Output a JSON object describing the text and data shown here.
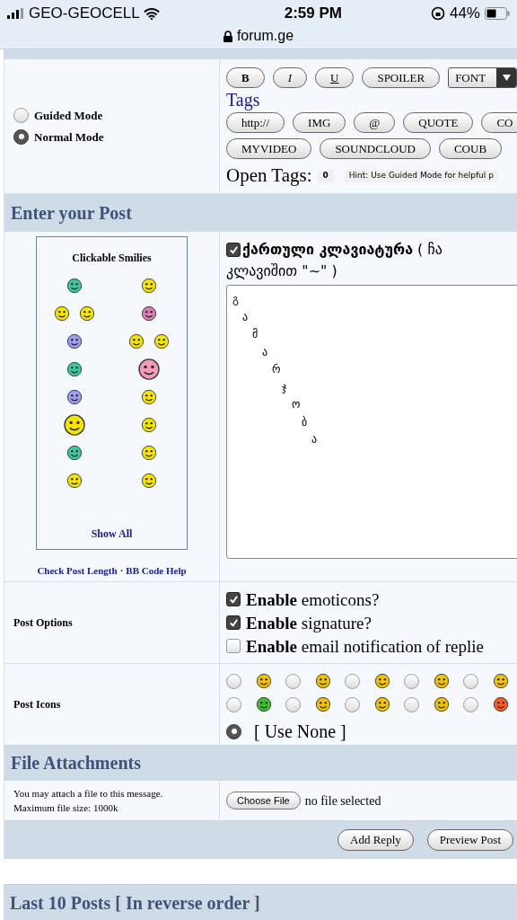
{
  "status_bar": {
    "carrier": "GEO-GEOCELL",
    "time": "2:59 PM",
    "battery": "44%",
    "url": "forum.ge"
  },
  "mode_options": [
    {
      "label": "Guided Mode",
      "selected": false
    },
    {
      "label": "Normal Mode",
      "selected": true
    }
  ],
  "format_buttons": [
    {
      "label": "B",
      "kind": "bold"
    },
    {
      "label": "I",
      "kind": "italic"
    },
    {
      "label": "U",
      "kind": "underline"
    },
    {
      "label": "SPOILER",
      "kind": "plain"
    }
  ],
  "font_select": {
    "value": "FONT"
  },
  "tags_title": "Tags",
  "tag_buttons": [
    "http://",
    "IMG",
    "@",
    "QUOTE",
    "CO",
    "MYVIDEO",
    "SOUNDCLOUD",
    "COUB"
  ],
  "open_tags": {
    "label": "Open Tags:",
    "count": "0",
    "hint": "Hint: Use Guided Mode for helpful p"
  },
  "post_section": {
    "title": "Enter your Post",
    "smilies_title": "Clickable Smilies",
    "show_all": "Show All",
    "links": [
      "Check Post Length",
      "BB Code Help"
    ],
    "separator": "·",
    "keyboard": {
      "checked": true,
      "label_lines": [
        "**ქართული კლავიატურა** ( ჩა",
        "კლავიშით \"~\" )"
      ]
    },
    "text_lines": [
      "გ",
      "ა",
      "მ",
      "ა",
      "რ",
      "ჯ",
      "ო",
      "ბ",
      "ა"
    ]
  },
  "post_options": {
    "label": "Post Options",
    "options": [
      {
        "text": "**Enable** emoticons?",
        "checked": true
      },
      {
        "text": "**Enable** signature?",
        "checked": true
      },
      {
        "text": "**Enable** email notification of replie",
        "checked": false
      }
    ]
  },
  "post_icons": {
    "label": "Post Icons",
    "icons": [
      {
        "selected": false
      },
      {
        "selected": false
      },
      {
        "selected": false
      },
      {
        "selected": false
      },
      {
        "selected": false
      },
      {
        "selected": false
      },
      {
        "selected": false
      },
      {
        "selected": false
      },
      {
        "selected": false
      },
      {
        "selected": false
      }
    ],
    "use_none": {
      "label": "[ Use None ]",
      "selected": true
    }
  },
  "attachments": {
    "title": "File Attachments",
    "note_lines": [
      "You may attach a file to this message.",
      "Maximum file size: 1000k"
    ],
    "choose_button": "Choose File",
    "status": "no file selected"
  },
  "actions": [
    "Add Reply",
    "Preview Post"
  ],
  "last_posts": {
    "title": "Last 10 Posts [ In reverse order ]"
  }
}
